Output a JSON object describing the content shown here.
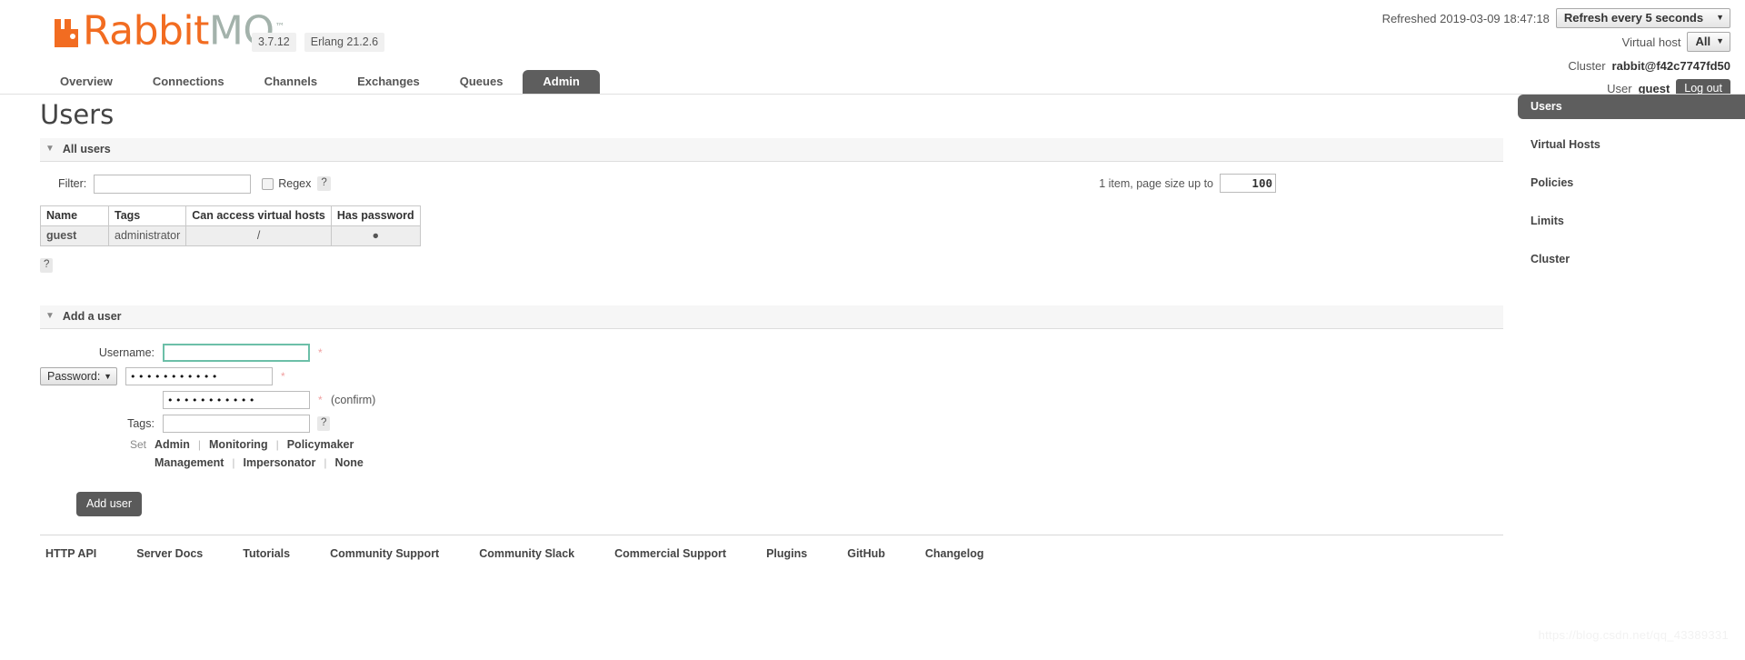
{
  "header": {
    "logo_rabbit": "Rabbit",
    "logo_mq": "MQ",
    "logo_tm": "™",
    "version": "3.7.12",
    "erlang_version": "Erlang 21.2.6",
    "refreshed_label": "Refreshed 2019-03-09 18:47:18",
    "refresh_select_value": "Refresh every 5 seconds",
    "virtual_host_label": "Virtual host",
    "virtual_host_value": "All",
    "cluster_label": "Cluster",
    "cluster_value": "rabbit@f42c7747fd50",
    "user_label": "User",
    "user_value": "guest",
    "logout_label": "Log out",
    "caret": "▼"
  },
  "nav": {
    "tabs": [
      {
        "label": "Overview",
        "active": false
      },
      {
        "label": "Connections",
        "active": false
      },
      {
        "label": "Channels",
        "active": false
      },
      {
        "label": "Exchanges",
        "active": false
      },
      {
        "label": "Queues",
        "active": false
      },
      {
        "label": "Admin",
        "active": true
      }
    ]
  },
  "page": {
    "title": "Users"
  },
  "all_users": {
    "section_label": "All users",
    "filter_label": "Filter:",
    "filter_value": "",
    "regex_label": "Regex",
    "help_glyph": "?",
    "pager_text": "1 item, page size up to",
    "page_size": "100",
    "columns": [
      "Name",
      "Tags",
      "Can access virtual hosts",
      "Has password"
    ],
    "rows": [
      {
        "name": "guest",
        "tags": "administrator",
        "vhosts": "/",
        "has_password": "●"
      }
    ]
  },
  "add_user": {
    "section_label": "Add a user",
    "username_label": "Username:",
    "username_value": "",
    "password_select_label": "Password:",
    "password_value": "•••••••••••",
    "password_confirm_value": "•••••••••••",
    "confirm_note": "(confirm)",
    "tags_label": "Tags:",
    "tags_value": "",
    "required_mark": "*",
    "set_label": "Set",
    "tag_presets_row1": [
      "Admin",
      "Monitoring",
      "Policymaker"
    ],
    "tag_presets_row2": [
      "Management",
      "Impersonator",
      "None"
    ],
    "separator": "|",
    "submit_label": "Add user"
  },
  "sidebar": {
    "items": [
      {
        "label": "Users",
        "active": true
      },
      {
        "label": "Virtual Hosts",
        "active": false
      },
      {
        "label": "Policies",
        "active": false
      },
      {
        "label": "Limits",
        "active": false
      },
      {
        "label": "Cluster",
        "active": false
      }
    ]
  },
  "footer": {
    "links": [
      "HTTP API",
      "Server Docs",
      "Tutorials",
      "Community Support",
      "Community Slack",
      "Commercial Support",
      "Plugins",
      "GitHub",
      "Changelog"
    ]
  },
  "watermark": {
    "text": "https://blog.csdn.net/qq_43389331"
  },
  "colors": {
    "brand_orange": "#f26c21",
    "brand_gray_green": "#a3b2ab",
    "active_tab": "#5e5e5e",
    "focus_teal": "#6cbfa8",
    "required_pink": "#f0a0a0"
  }
}
